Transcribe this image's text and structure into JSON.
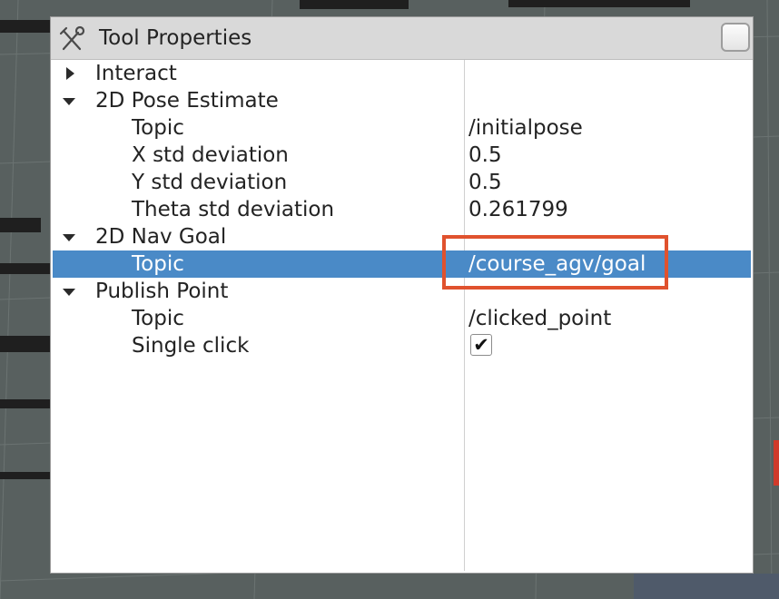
{
  "panel": {
    "title": "Tool Properties",
    "title_icon": "tools-icon",
    "close_button_icon": "window-button"
  },
  "tree": [
    {
      "name": "Interact",
      "value": "",
      "expanded": false,
      "level": 0
    },
    {
      "name": "2D Pose Estimate",
      "value": "",
      "expanded": true,
      "level": 0
    },
    {
      "name": "Topic",
      "value": "/initialpose",
      "level": 1
    },
    {
      "name": "X std deviation",
      "value": "0.5",
      "level": 1
    },
    {
      "name": "Y std deviation",
      "value": "0.5",
      "level": 1
    },
    {
      "name": "Theta std deviation",
      "value": "0.261799",
      "level": 1
    },
    {
      "name": "2D Nav Goal",
      "value": "",
      "expanded": true,
      "level": 0
    },
    {
      "name": "Topic",
      "value": "/course_agv/goal",
      "level": 1,
      "selected": true
    },
    {
      "name": "Publish Point",
      "value": "",
      "expanded": true,
      "level": 0
    },
    {
      "name": "Topic",
      "value": "/clicked_point",
      "level": 1
    },
    {
      "name": "Single click",
      "value": "",
      "level": 1,
      "checkbox": true,
      "checked": true
    }
  ],
  "checkbox_mark": "✔",
  "colors": {
    "selection": "#4a8ac7",
    "highlight_box": "#e0522e",
    "background": "#58605f"
  }
}
